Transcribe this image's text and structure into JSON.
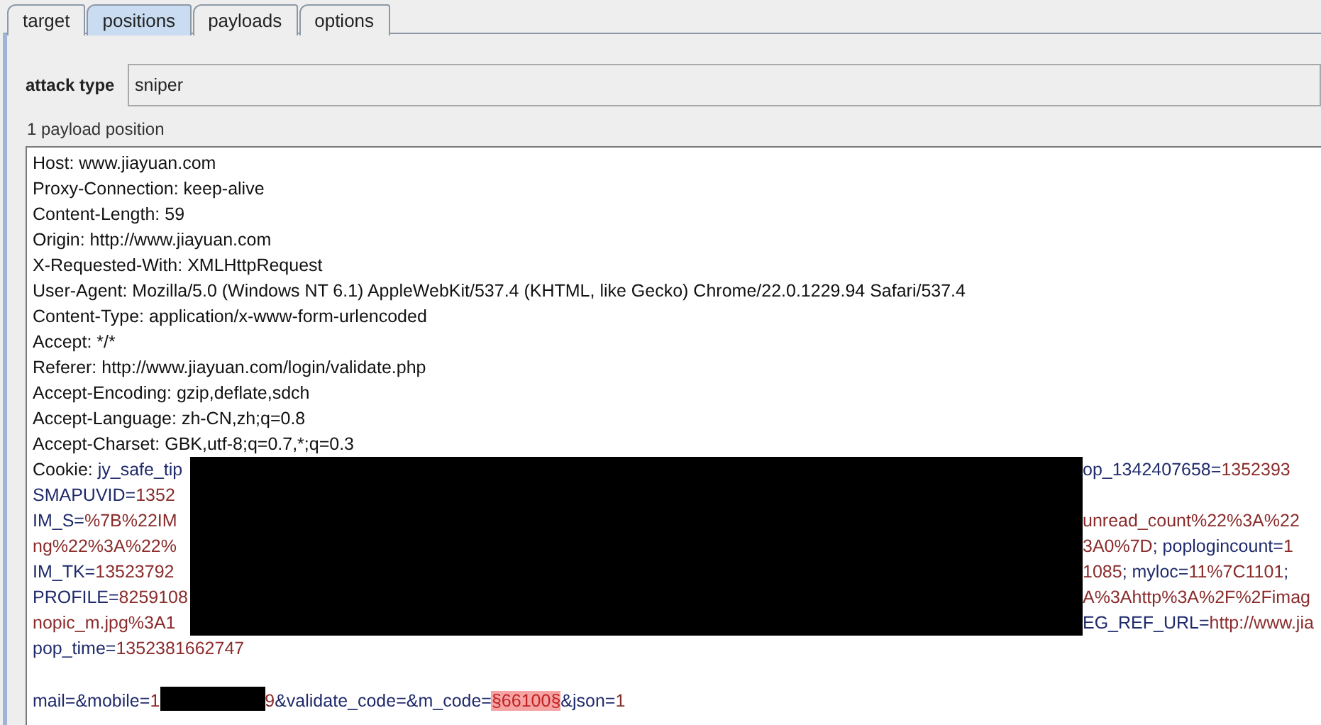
{
  "tabs": [
    {
      "label": "target",
      "selected": false
    },
    {
      "label": "positions",
      "selected": true
    },
    {
      "label": "payloads",
      "selected": false
    },
    {
      "label": "options",
      "selected": false
    }
  ],
  "attack_type": {
    "label": "attack type",
    "value": "sniper"
  },
  "payload_count": "1 payload position",
  "editor": {
    "blocks": [
      {
        "kind": "lines",
        "lines": [
          {
            "segments": [
              {
                "text": "Host: www.jiayuan.com",
                "kind": "plain"
              }
            ]
          },
          {
            "segments": [
              {
                "text": "Proxy-Connection: keep-alive",
                "kind": "plain"
              }
            ]
          },
          {
            "segments": [
              {
                "text": "Content-Length: 59",
                "kind": "plain"
              }
            ]
          },
          {
            "segments": [
              {
                "text": "Origin: http://www.jiayuan.com",
                "kind": "plain"
              }
            ]
          },
          {
            "segments": [
              {
                "text": "X-Requested-With: XMLHttpRequest",
                "kind": "plain"
              }
            ]
          },
          {
            "segments": [
              {
                "text": "User-Agent: Mozilla/5.0 (Windows NT 6.1) AppleWebKit/537.4 (KHTML, like Gecko) Chrome/22.0.1229.94 Safari/537.4",
                "kind": "plain"
              }
            ]
          },
          {
            "segments": [
              {
                "text": "Content-Type: application/x-www-form-urlencoded",
                "kind": "plain"
              }
            ]
          },
          {
            "segments": [
              {
                "text": "Accept: */*",
                "kind": "plain"
              }
            ]
          },
          {
            "segments": [
              {
                "text": "Referer: http://www.jiayuan.com/login/validate.php",
                "kind": "plain"
              }
            ]
          },
          {
            "segments": [
              {
                "text": "Accept-Encoding: gzip,deflate,sdch",
                "kind": "plain"
              }
            ]
          },
          {
            "segments": [
              {
                "text": "Accept-Language: zh-CN,zh;q=0.8",
                "kind": "plain"
              }
            ]
          },
          {
            "segments": [
              {
                "text": "Accept-Charset: GBK,utf-8;q=0.7,*;q=0.3",
                "kind": "plain"
              }
            ]
          }
        ]
      },
      {
        "kind": "redacted",
        "rows": [
          {
            "left": [
              {
                "text": "Cookie: ",
                "kind": "plain"
              },
              {
                "text": "jy_safe_tip",
                "kind": "name"
              }
            ],
            "right": [
              {
                "text": "op_1342407658=",
                "kind": "name"
              },
              {
                "text": "1352393",
                "kind": "value"
              }
            ]
          },
          {
            "left": [
              {
                "text": "SMAPUVID=",
                "kind": "name"
              },
              {
                "text": "1352",
                "kind": "value"
              }
            ]
          },
          {
            "left": [
              {
                "text": "IM_S=",
                "kind": "name"
              },
              {
                "text": "%7B%22IM",
                "kind": "value"
              }
            ],
            "right": [
              {
                "text": "unread_count%22%3A%22",
                "kind": "value"
              }
            ]
          },
          {
            "left": [
              {
                "text": "ng%22%3A%22%",
                "kind": "value"
              }
            ],
            "right": [
              {
                "text": "3A0%7D",
                "kind": "value"
              },
              {
                "text": "; poplogincount=",
                "kind": "name"
              },
              {
                "text": "1",
                "kind": "value"
              }
            ]
          },
          {
            "left": [
              {
                "text": "IM_TK=",
                "kind": "name"
              },
              {
                "text": "13523792",
                "kind": "value"
              }
            ],
            "right": [
              {
                "text": "1085",
                "kind": "value"
              },
              {
                "text": "; myloc=",
                "kind": "name"
              },
              {
                "text": "11%7C1101",
                "kind": "value"
              },
              {
                "text": ";",
                "kind": "name"
              }
            ]
          },
          {
            "left": [
              {
                "text": "PROFILE=",
                "kind": "name"
              },
              {
                "text": "8259108",
                "kind": "value"
              }
            ],
            "right": [
              {
                "text": "A%3Ahttp%3A%2F%2Fimag",
                "kind": "value"
              }
            ]
          },
          {
            "left": [
              {
                "text": "nopic_m.jpg%3A1",
                "kind": "value"
              }
            ],
            "right": [
              {
                "text": "EG_REF_URL=",
                "kind": "name"
              },
              {
                "text": "http://www.jia",
                "kind": "value"
              }
            ]
          }
        ]
      },
      {
        "kind": "lines",
        "lines": [
          {
            "segments": [
              {
                "text": "pop_time=",
                "kind": "name"
              },
              {
                "text": "1352381662747",
                "kind": "value"
              }
            ]
          }
        ]
      },
      {
        "kind": "gap"
      },
      {
        "kind": "lines",
        "lines": [
          {
            "segments": [
              {
                "text": "mail=&mobile=",
                "kind": "name"
              },
              {
                "text": "1",
                "kind": "value"
              },
              {
                "kind": "redaction"
              },
              {
                "text": "9",
                "kind": "value"
              },
              {
                "text": "&validate_code=&m_code=",
                "kind": "name"
              },
              {
                "text": "§66100§",
                "kind": "payload"
              },
              {
                "text": "&json=",
                "kind": "name"
              },
              {
                "text": "1",
                "kind": "value"
              }
            ]
          }
        ]
      }
    ]
  }
}
